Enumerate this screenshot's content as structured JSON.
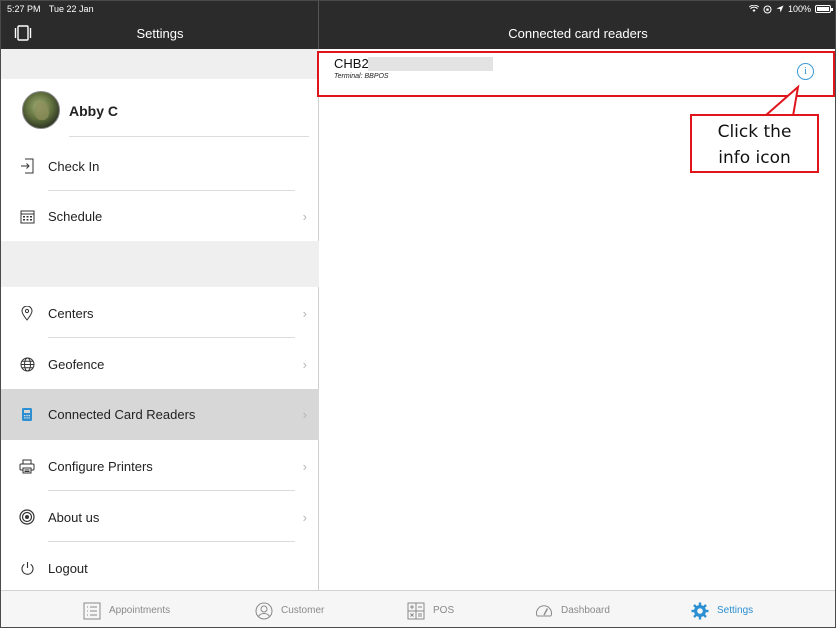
{
  "status_bar": {
    "time": "5:27 PM",
    "date": "Tue 22 Jan",
    "battery": "100%"
  },
  "nav": {
    "left_title": "Settings",
    "right_title": "Connected card readers"
  },
  "profile": {
    "name": "Abby C"
  },
  "menu": {
    "check_in": "Check In",
    "schedule": "Schedule",
    "centers": "Centers",
    "geofence": "Geofence",
    "connected_card_readers": "Connected Card Readers",
    "configure_printers": "Configure Printers",
    "about_us": "About us",
    "logout": "Logout"
  },
  "reader": {
    "name": "CHB2",
    "terminal": "Terminal: BBPOS",
    "info_glyph": "i"
  },
  "callout": {
    "line1": "Click the",
    "line2": "info icon"
  },
  "tabs": {
    "appointments": "Appointments",
    "customer": "Customer",
    "pos": "POS",
    "dashboard": "Dashboard",
    "settings": "Settings"
  },
  "colors": {
    "accent": "#2b8fd1",
    "annotation": "#e0141b",
    "navbar": "#2b2b2b",
    "selected_row": "#d7d7d7"
  },
  "icons": {
    "sidebar_toggle": "sidebar-toggle-icon",
    "check_in": "check-in-icon",
    "schedule": "calendar-icon",
    "centers": "location-pin-icon",
    "geofence": "globe-icon",
    "card_readers": "card-reader-icon",
    "printers": "printer-icon",
    "about": "target-icon",
    "logout": "power-icon"
  }
}
